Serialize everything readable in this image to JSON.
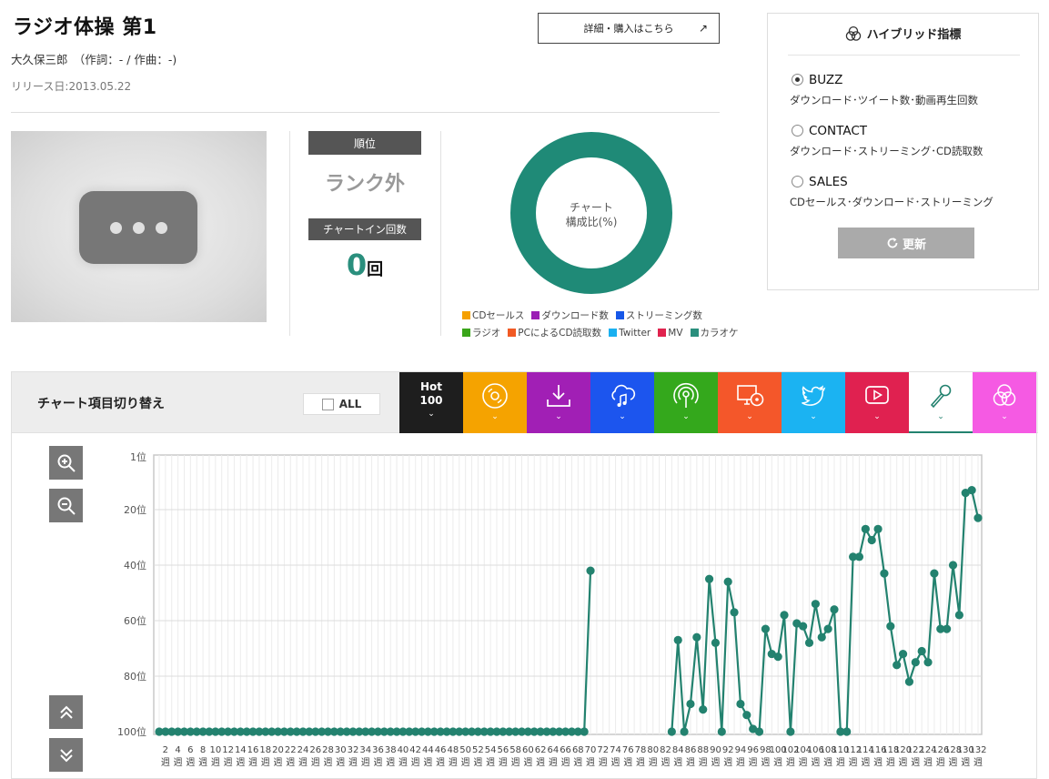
{
  "song": {
    "title": "ラジオ体操 第1",
    "artist_line": "大久保三郎　（作詞：- / 作曲：-)",
    "release": "リリース日:2013.05.22"
  },
  "detail_button": {
    "label": "詳細・購入はこちら",
    "arrow": "↗"
  },
  "stats": {
    "rank_label": "順位",
    "rank_value": "ランク外",
    "count_label": "チャートイン回数",
    "count_value": "0",
    "count_unit": "回"
  },
  "composition": {
    "center_text_1": "チャート",
    "center_text_2": "構成比(%)",
    "legend": [
      {
        "label": "CDセールス",
        "color": "#f5a000"
      },
      {
        "label": "ダウンロード数",
        "color": "#9b1fb5"
      },
      {
        "label": "ストリーミング数",
        "color": "#1657e8"
      },
      {
        "label": "ラジオ",
        "color": "#3aa51a"
      },
      {
        "label": "PCによるCD読取数",
        "color": "#f15a24"
      },
      {
        "label": "Twitter",
        "color": "#1ab0f0"
      },
      {
        "label": "MV",
        "color": "#e0234e"
      },
      {
        "label": "カラオケ",
        "color": "#2a8f7d"
      }
    ],
    "donut_color": "#1f8a77"
  },
  "hybrid": {
    "title": "ハイブリッド指標",
    "options": [
      {
        "name": "BUZZ",
        "desc": "ダウンロード･ツイート数･動画再生回数",
        "selected": true
      },
      {
        "name": "CONTACT",
        "desc": "ダウンロード･ストリーミング･CD読取数",
        "selected": false
      },
      {
        "name": "SALES",
        "desc": "CDセールス･ダウンロード･ストリーミング",
        "selected": false
      }
    ],
    "refresh_label": "更新"
  },
  "chart_switch": {
    "label": "チャート項目切り替え",
    "all_label": "ALL",
    "hot_label_1": "Hot",
    "hot_label_2": "100",
    "tabs": [
      {
        "name": "hot100",
        "color": "#1e1e1e",
        "icon": "hot100"
      },
      {
        "name": "cd-sales",
        "color": "#f5a300",
        "icon": "disc-icon"
      },
      {
        "name": "download",
        "color": "#a11fb5",
        "icon": "download-icon"
      },
      {
        "name": "streaming",
        "color": "#1c55ee",
        "icon": "cloud-music-icon"
      },
      {
        "name": "radio",
        "color": "#34a81c",
        "icon": "radio-icon"
      },
      {
        "name": "pc-cd-read",
        "color": "#f4572a",
        "icon": "pc-disc-icon"
      },
      {
        "name": "twitter",
        "color": "#1bb3f2",
        "icon": "twitter-icon"
      },
      {
        "name": "mv",
        "color": "#e02150",
        "icon": "play-icon"
      },
      {
        "name": "karaoke",
        "color": "#ffffff",
        "icon": "microphone-icon",
        "selected": true
      },
      {
        "name": "hybrid",
        "color": "#f55ae3",
        "icon": "venn-icon"
      }
    ]
  },
  "chart_data": {
    "type": "line",
    "series_color": "#23826f",
    "y_ticks": [
      "1位",
      "20位",
      "40位",
      "60位",
      "80位",
      "100位"
    ],
    "y_tick_values": [
      1,
      20,
      40,
      60,
      80,
      100
    ],
    "ylim": [
      1,
      100
    ],
    "y_inverted": true,
    "x_tick_labels": [
      "2",
      "4",
      "6",
      "8",
      "10",
      "12",
      "14",
      "16",
      "18",
      "20",
      "22",
      "24",
      "26",
      "28",
      "30",
      "32",
      "34",
      "36",
      "38",
      "40",
      "42",
      "44",
      "46",
      "48",
      "50",
      "52",
      "54",
      "56",
      "58",
      "60",
      "62",
      "64",
      "66",
      "68",
      "70",
      "72",
      "74",
      "76",
      "78",
      "80",
      "82",
      "84",
      "86",
      "88",
      "90",
      "92",
      "94",
      "96",
      "98",
      "100",
      "102",
      "104",
      "106",
      "108",
      "110",
      "112",
      "114",
      "116",
      "118",
      "120",
      "122",
      "124",
      "126",
      "128",
      "130",
      "132"
    ],
    "x_unit": "週",
    "x": [
      1,
      2,
      3,
      4,
      5,
      6,
      7,
      8,
      9,
      10,
      11,
      12,
      13,
      14,
      15,
      16,
      17,
      18,
      19,
      20,
      21,
      22,
      23,
      24,
      25,
      26,
      27,
      28,
      29,
      30,
      31,
      32,
      33,
      34,
      35,
      36,
      37,
      38,
      39,
      40,
      41,
      42,
      43,
      44,
      45,
      46,
      47,
      48,
      49,
      50,
      51,
      52,
      53,
      54,
      55,
      56,
      57,
      58,
      59,
      60,
      61,
      62,
      63,
      64,
      65,
      66,
      67,
      68,
      69,
      70,
      71,
      72,
      73,
      74,
      75,
      76,
      77,
      78,
      79,
      80,
      81,
      82,
      83,
      84,
      85,
      86,
      87,
      88,
      89,
      90,
      91,
      92,
      93,
      94,
      95,
      96,
      97,
      98,
      99,
      100,
      101,
      102,
      103,
      104,
      105,
      106,
      107,
      108,
      109,
      110,
      111,
      112,
      113,
      114,
      115,
      116,
      117,
      118,
      119,
      120,
      121,
      122,
      123,
      124,
      125,
      126,
      127,
      128,
      129,
      130,
      131,
      132
    ],
    "y": [
      100,
      100,
      100,
      100,
      100,
      100,
      100,
      100,
      100,
      100,
      100,
      100,
      100,
      100,
      100,
      100,
      100,
      100,
      100,
      100,
      100,
      100,
      100,
      100,
      100,
      100,
      100,
      100,
      100,
      100,
      100,
      100,
      100,
      100,
      100,
      100,
      100,
      100,
      100,
      100,
      100,
      100,
      100,
      100,
      100,
      100,
      100,
      100,
      100,
      100,
      100,
      100,
      100,
      100,
      100,
      100,
      100,
      100,
      100,
      100,
      100,
      100,
      100,
      100,
      100,
      100,
      100,
      100,
      100,
      42,
      null,
      null,
      null,
      null,
      null,
      null,
      null,
      null,
      null,
      null,
      null,
      null,
      100,
      67,
      100,
      90,
      66,
      92,
      45,
      68,
      100,
      46,
      57,
      90,
      94,
      99,
      100,
      63,
      72,
      73,
      58,
      100,
      61,
      62,
      68,
      54,
      66,
      63,
      56,
      100,
      100,
      37,
      37,
      27,
      31,
      27,
      43,
      62,
      76,
      72,
      82,
      75,
      71,
      75,
      43,
      63,
      63,
      40,
      58,
      14,
      13,
      23
    ]
  }
}
